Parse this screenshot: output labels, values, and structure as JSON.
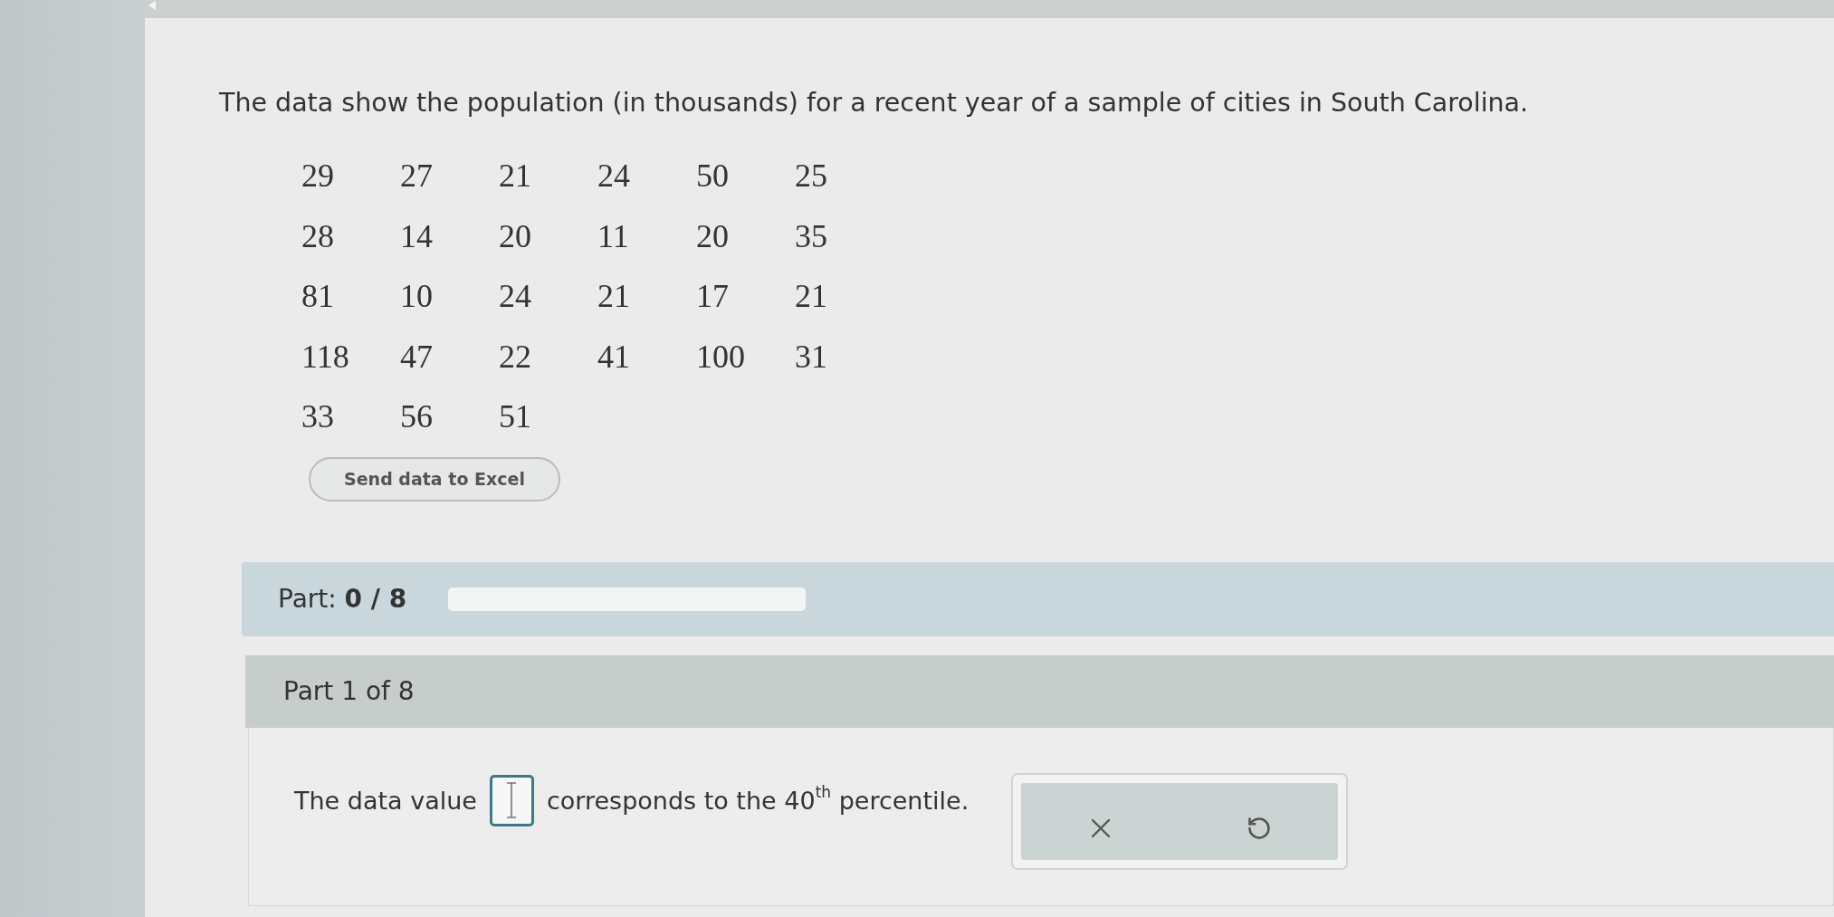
{
  "question": "The data show the population (in thousands) for a recent year of a sample of cities in South Carolina.",
  "data_table": {
    "rows": [
      [
        "29",
        "27",
        "21",
        "24",
        "50",
        "25"
      ],
      [
        "28",
        "14",
        "20",
        "11",
        "20",
        "35"
      ],
      [
        "81",
        "10",
        "24",
        "21",
        "17",
        "21"
      ],
      [
        "118",
        "47",
        "22",
        "41",
        "100",
        "31"
      ],
      [
        "33",
        "56",
        "51"
      ]
    ]
  },
  "send_button": "Send data to Excel",
  "progress": {
    "label": "Part: **0 / 8**",
    "level": 0
  },
  "part": {
    "title": "Part 1 of 8",
    "prompt_before": "The data value",
    "prompt_after": "corresponds to the 40$^{th}$ percentile."
  },
  "actions": [
    {
      "kind": "clear"
    },
    {
      "kind": "undo"
    }
  ]
}
